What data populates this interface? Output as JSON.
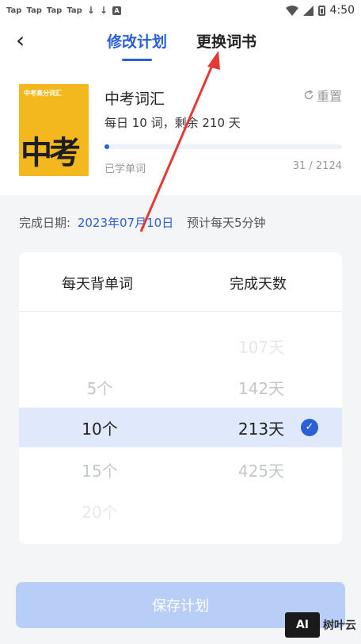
{
  "status_bar": {
    "notifications": [
      "Tap",
      "Tap",
      "Tap",
      "Tap"
    ],
    "download_icons": [
      "↓",
      "↓"
    ],
    "app_icon": "A",
    "time": "4:50"
  },
  "nav": {
    "back": "‹",
    "tab_plan": "修改计划",
    "tab_change_book": "更换词书"
  },
  "book": {
    "cover_top_text": "中考高分词汇",
    "cover_big_text": "中考",
    "title": "中考词汇",
    "reset_label": "重置",
    "meta": "每日 10 词，剩余 210 天",
    "learned_label": "已学单词",
    "learned_count": "31 / 2124",
    "progress": 0.015
  },
  "date_row": {
    "label": "完成日期:",
    "date": "2023年07月10日",
    "estimate": "预计每天5分钟"
  },
  "picker": {
    "col_words": "每天背单词",
    "col_days": "完成天数",
    "words_options": [
      "5个",
      "10个",
      "15个",
      "20个"
    ],
    "days_options": [
      "107天",
      "142天",
      "213天",
      "425天"
    ]
  },
  "save_label": "保存计划",
  "watermark": {
    "box": "AI",
    "text": "树叶云"
  },
  "colors": {
    "accent": "#2a5fd6",
    "selected_band": "#dfe9fb",
    "save_disabled": "#b8cef6",
    "annotation_arrow": "#e53935"
  }
}
